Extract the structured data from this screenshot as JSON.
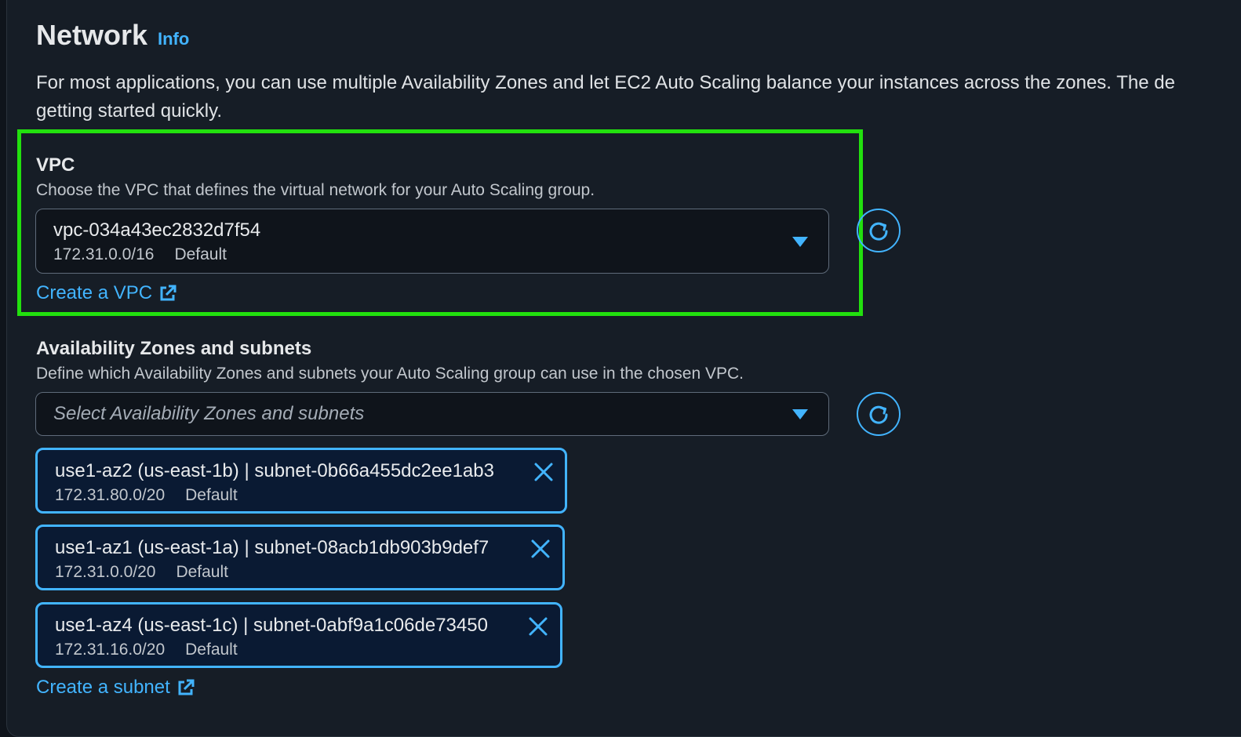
{
  "section": {
    "title": "Network",
    "info_label": "Info",
    "description_line1": "For most applications, you can use multiple Availability Zones and let EC2 Auto Scaling balance your instances across the zones. The de",
    "description_line2": "getting started quickly."
  },
  "vpc": {
    "label": "VPC",
    "hint": "Choose the VPC that defines the virtual network for your Auto Scaling group.",
    "selected_id": "vpc-034a43ec2832d7f54",
    "selected_cidr": "172.31.0.0/16",
    "selected_tag": "Default",
    "create_link": "Create a VPC"
  },
  "subnets": {
    "label": "Availability Zones and subnets",
    "hint": "Define which Availability Zones and subnets your Auto Scaling group can use in the chosen VPC.",
    "placeholder": "Select Availability Zones and subnets",
    "tokens": [
      {
        "title": "use1-az2 (us-east-1b) | subnet-0b66a455dc2ee1ab3",
        "cidr": "172.31.80.0/20",
        "tag": "Default"
      },
      {
        "title": "use1-az1 (us-east-1a) | subnet-08acb1db903b9def7",
        "cidr": "172.31.0.0/20",
        "tag": "Default"
      },
      {
        "title": "use1-az4 (us-east-1c) | subnet-0abf9a1c06de73450",
        "cidr": "172.31.16.0/20",
        "tag": "Default"
      }
    ],
    "create_link": "Create a subnet"
  },
  "colors": {
    "accent": "#42b4ff",
    "highlight": "#22e00e",
    "panel": "#161d26"
  },
  "icons": {
    "refresh": "refresh-icon",
    "external": "external-link-icon",
    "dismiss": "close-icon",
    "caret": "caret-down-icon"
  }
}
